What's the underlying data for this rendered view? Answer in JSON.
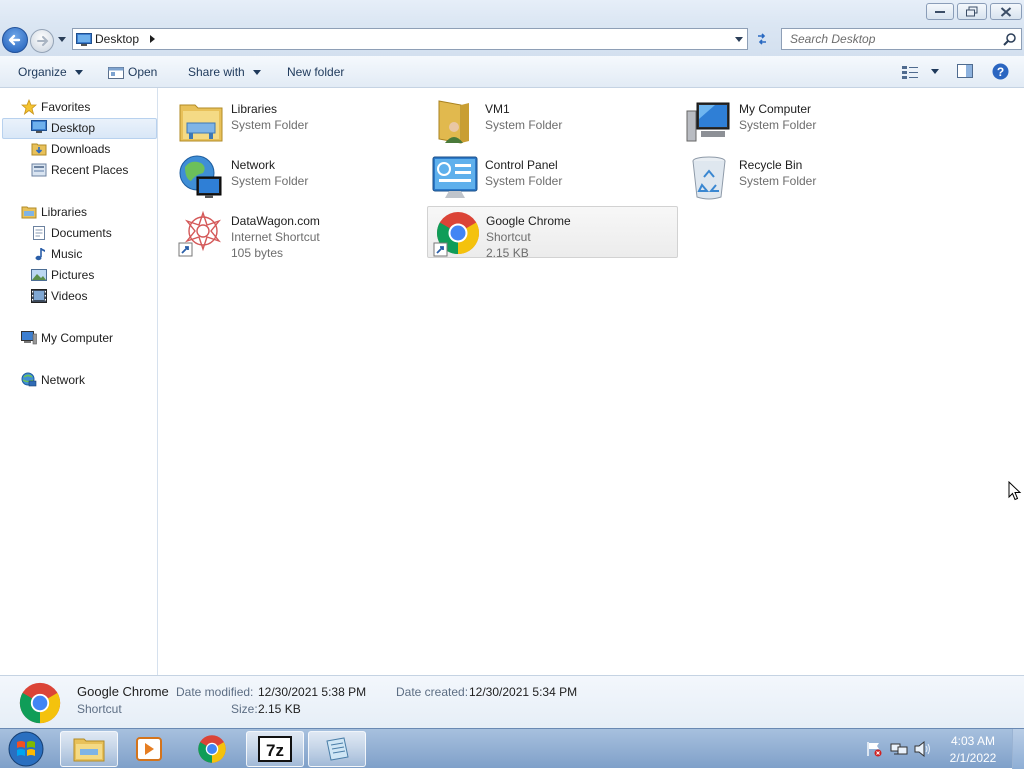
{
  "window": {
    "minimize_icon": "minimize-icon",
    "restore_icon": "restore-icon",
    "close_icon": "close-icon"
  },
  "address": {
    "location": "Desktop",
    "search_placeholder": "Search Desktop"
  },
  "toolbar": {
    "organize": "Organize",
    "open": "Open",
    "share_with": "Share with",
    "new_folder": "New folder"
  },
  "nav": {
    "favorites": "Favorites",
    "desktop": "Desktop",
    "downloads": "Downloads",
    "recent_places": "Recent Places",
    "libraries": "Libraries",
    "documents": "Documents",
    "music": "Music",
    "pictures": "Pictures",
    "videos": "Videos",
    "my_computer": "My Computer",
    "network": "Network"
  },
  "items": [
    {
      "name": "Libraries",
      "type": "System Folder",
      "icon": "libraries-icon"
    },
    {
      "name": "VM1",
      "type": "System Folder",
      "icon": "user-folder-icon"
    },
    {
      "name": "My Computer",
      "type": "System Folder",
      "icon": "computer-icon"
    },
    {
      "name": "Network",
      "type": "System Folder",
      "icon": "network-icon"
    },
    {
      "name": "Control Panel",
      "type": "System Folder",
      "icon": "control-panel-icon"
    },
    {
      "name": "Recycle Bin",
      "type": "System Folder",
      "icon": "recycle-bin-icon"
    },
    {
      "name": "DataWagon.com",
      "type": "Internet Shortcut",
      "size": "105 bytes",
      "icon": "internet-shortcut-icon"
    },
    {
      "name": "Google Chrome",
      "type": "Shortcut",
      "size": "2.15 KB",
      "icon": "chrome-icon",
      "selected": true
    }
  ],
  "details": {
    "name": "Google Chrome",
    "type": "Shortcut",
    "date_modified_label": "Date modified:",
    "date_modified": "12/30/2021 5:38 PM",
    "date_created_label": "Date created:",
    "date_created": "12/30/2021 5:34 PM",
    "size_label": "Size:",
    "size": "2.15 KB"
  },
  "taskbar": {
    "apps": [
      "explorer-icon",
      "media-player-icon",
      "chrome-icon",
      "7zip-icon",
      "notepad-icon"
    ],
    "sevenzip_label": "7z",
    "time": "4:03 AM",
    "date": "2/1/2022"
  }
}
